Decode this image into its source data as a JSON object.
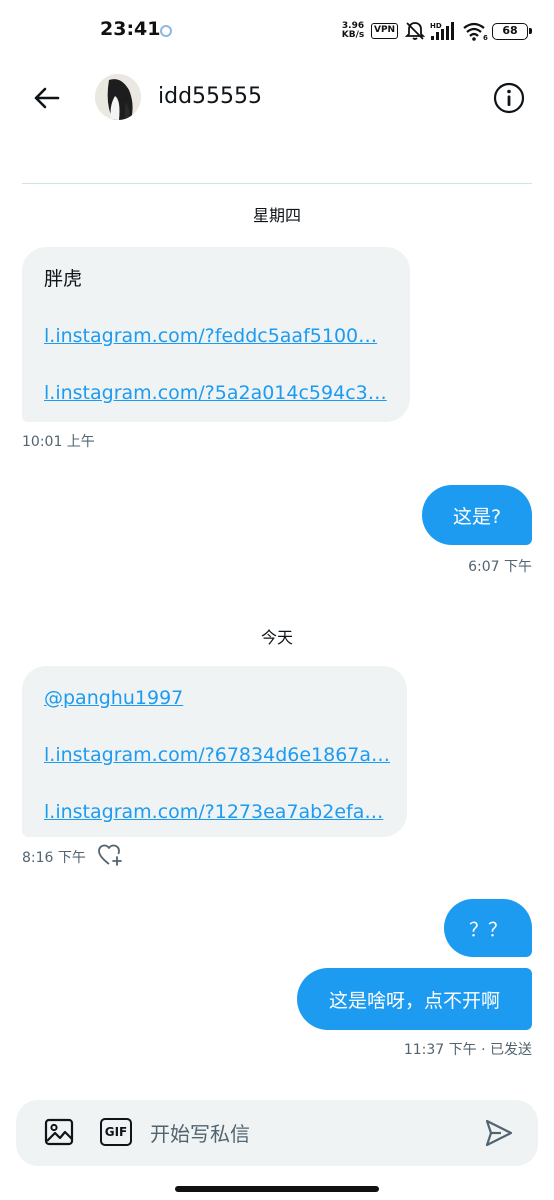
{
  "status_bar": {
    "time": "23:41",
    "net_speed_value": "3.96",
    "net_speed_unit": "KB/s",
    "vpn": "VPN",
    "battery": "68"
  },
  "header": {
    "name": "idd55555"
  },
  "messages": {
    "day1": "星期四",
    "in1": {
      "text": "胖虎",
      "link1": "l.instagram.com/?feddc5aaf5100…",
      "link2": "l.instagram.com/?5a2a014c594c3…",
      "time": "10:01 上午"
    },
    "out1": {
      "text": "这是?",
      "time": "6:07 下午"
    },
    "day2": "今天",
    "in2": {
      "mention": "@panghu1997",
      "link1": "l.instagram.com/?67834d6e1867a…",
      "link2": "l.instagram.com/?1273ea7ab2efa…",
      "time": "8:16 下午"
    },
    "out2": {
      "text": "？？"
    },
    "out3": {
      "text": "这是啥呀，点不开啊",
      "time": "11:37 下午 · 已发送"
    }
  },
  "composer": {
    "placeholder": "开始写私信",
    "gif_label": "GIF"
  },
  "colors": {
    "accent": "#1d9bf0",
    "incoming_bubble": "#eff3f4",
    "secondary_text": "#536471"
  }
}
